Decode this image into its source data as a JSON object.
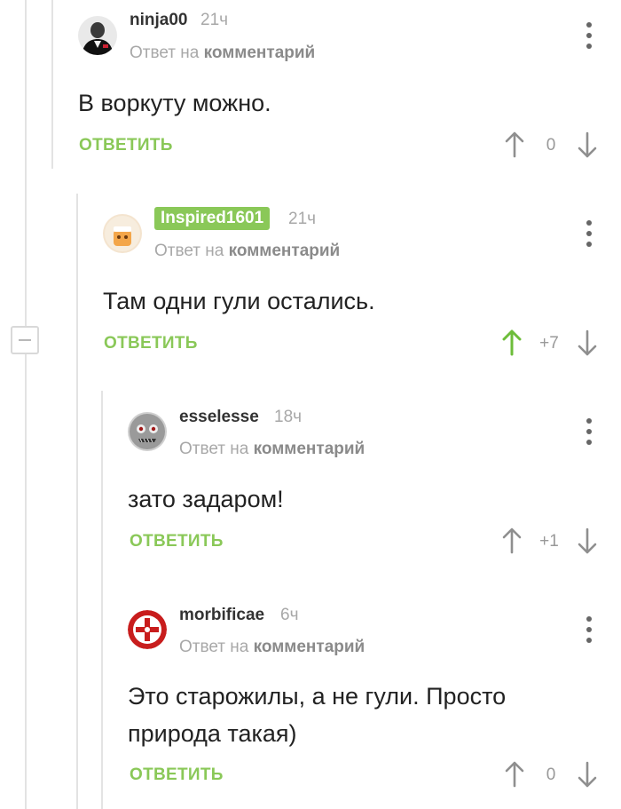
{
  "comments": [
    {
      "username": "ninja00",
      "time": "21ч",
      "reply_prefix": "Ответ на",
      "reply_target": "комментарий",
      "text": "В воркуту можно.",
      "answer_label": "ОТВЕТИТЬ",
      "rating": "0",
      "upvoted": false
    },
    {
      "username": "Inspired1601",
      "time": "21ч",
      "reply_prefix": "Ответ на",
      "reply_target": "комментарий",
      "text": "Там одни гули остались.",
      "answer_label": "ОТВЕТИТЬ",
      "rating": "+7",
      "upvoted": true
    },
    {
      "username": "esselesse",
      "time": "18ч",
      "reply_prefix": "Ответ на",
      "reply_target": "комментарий",
      "text": "зато задаром!",
      "answer_label": "ОТВЕТИТЬ",
      "rating": "+1",
      "upvoted": false
    },
    {
      "username": "morbificae",
      "time": "6ч",
      "reply_prefix": "Ответ на",
      "reply_target": "комментарий",
      "text": "Это старожилы, а не гули. Просто природа такая)",
      "answer_label": "ОТВЕТИТЬ",
      "rating": "0",
      "upvoted": false
    }
  ],
  "colors": {
    "accent_green": "#8ac858",
    "muted_text": "#a8a8a8",
    "thread_line": "#e3e3e3",
    "arrow_default": "#8f8f8f"
  },
  "icons": {
    "collapse": "minus-square-icon",
    "more": "vertical-dots-icon",
    "upvote": "arrow-up-icon",
    "downvote": "arrow-down-icon"
  }
}
